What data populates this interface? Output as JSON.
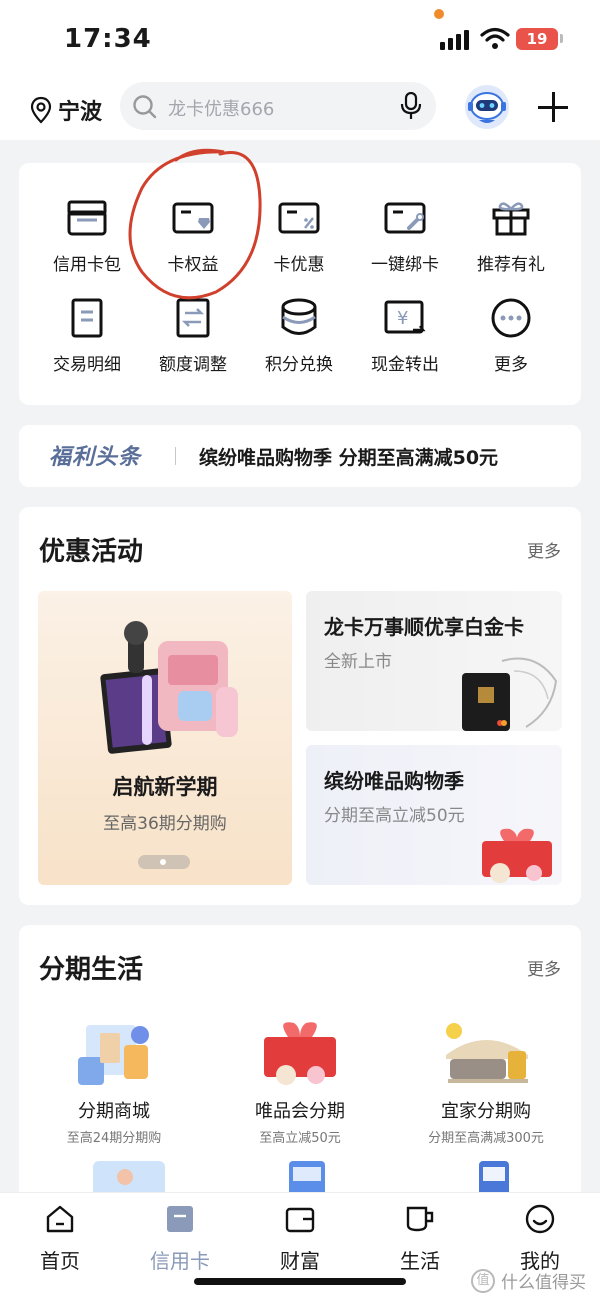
{
  "status_bar": {
    "time": "17:34",
    "battery": "19"
  },
  "header": {
    "city": "宁波",
    "search_placeholder": "龙卡优惠666"
  },
  "quick_grid": [
    {
      "label": "信用卡包",
      "icon": "card-wallet-icon"
    },
    {
      "label": "卡权益",
      "icon": "card-benefit-icon"
    },
    {
      "label": "卡优惠",
      "icon": "card-discount-icon"
    },
    {
      "label": "一键绑卡",
      "icon": "card-bind-icon"
    },
    {
      "label": "推荐有礼",
      "icon": "gift-icon"
    },
    {
      "label": "交易明细",
      "icon": "transaction-detail-icon"
    },
    {
      "label": "额度调整",
      "icon": "limit-adjust-icon"
    },
    {
      "label": "积分兑换",
      "icon": "points-exchange-icon"
    },
    {
      "label": "现金转出",
      "icon": "cash-transfer-icon"
    },
    {
      "label": "更多",
      "icon": "more-icon"
    }
  ],
  "headline": {
    "tag": "福利头条",
    "text": "缤纷唯品购物季 分期至高满减50元"
  },
  "promotions": {
    "title": "优惠活动",
    "more": "更多",
    "main": {
      "title": "启航新学期",
      "subtitle": "至高36期分期购"
    },
    "side": [
      {
        "title": "龙卡万事顺优享白金卡",
        "subtitle": "全新上市"
      },
      {
        "title": "缤纷唯品购物季",
        "subtitle": "分期至高立减50元"
      }
    ]
  },
  "installment": {
    "title": "分期生活",
    "more": "更多",
    "items": [
      {
        "name": "分期商城",
        "sub": "至高24期分期购"
      },
      {
        "name": "唯品会分期",
        "sub": "至高立减50元"
      },
      {
        "name": "宜家分期购",
        "sub": "分期至高满减300元"
      }
    ]
  },
  "tabbar": [
    {
      "label": "首页",
      "icon": "home-icon",
      "active": false
    },
    {
      "label": "信用卡",
      "icon": "credit-card-icon",
      "active": true
    },
    {
      "label": "财富",
      "icon": "wallet-icon",
      "active": false
    },
    {
      "label": "生活",
      "icon": "cup-icon",
      "active": false
    },
    {
      "label": "我的",
      "icon": "smile-icon",
      "active": false
    }
  ],
  "watermark": "什么值得买",
  "colors": {
    "accent_active": "#8a9ab8",
    "annotation_red": "#d0402c",
    "battery": "#e9534a"
  }
}
